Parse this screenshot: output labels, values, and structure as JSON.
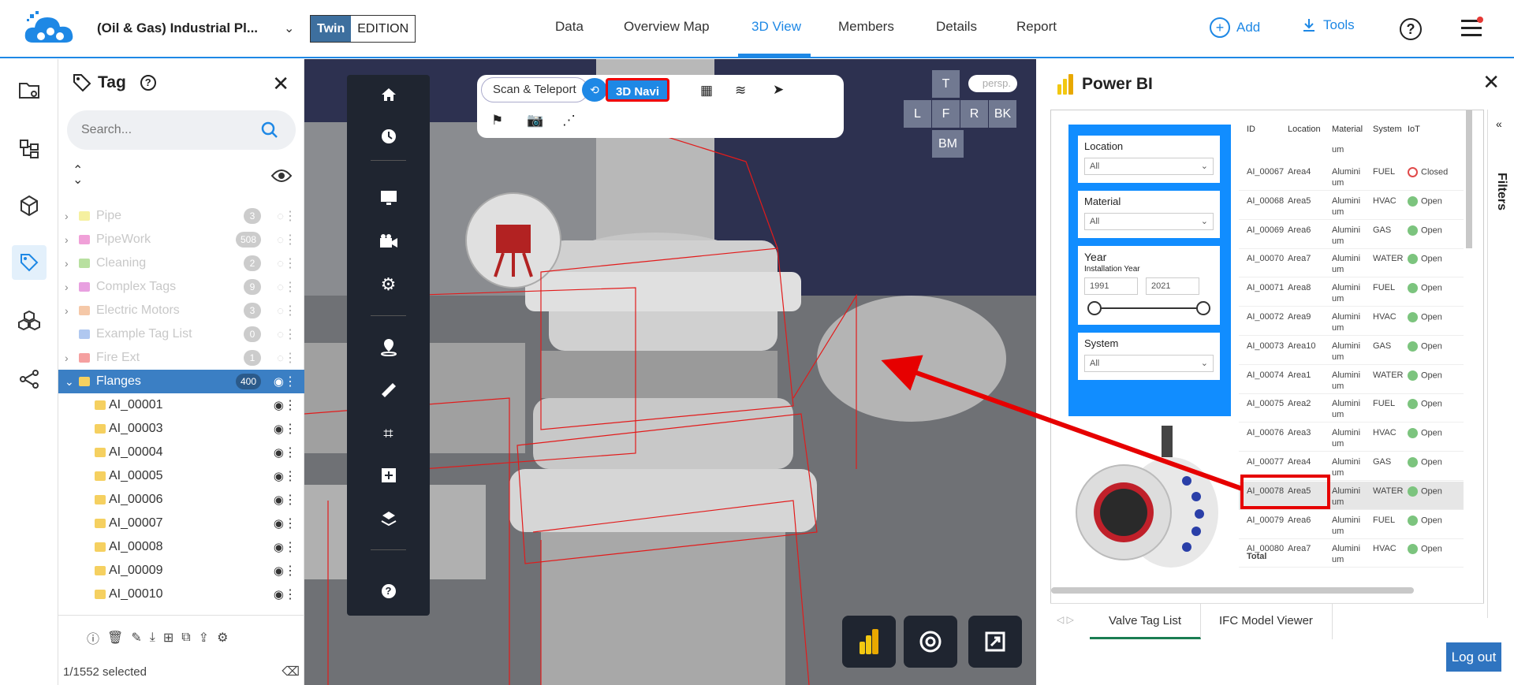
{
  "header": {
    "project": "(Oil & Gas) Industrial Pl...",
    "edition_twin": "Twin",
    "edition_label": "EDITION",
    "nav": [
      "Data",
      "Overview Map",
      "3D View",
      "Members",
      "Details",
      "Report"
    ],
    "active_nav": "3D View",
    "add_label": "Add",
    "tools_label": "Tools",
    "accent_color": "#1e88e5"
  },
  "rail": {
    "icons": [
      "folder-map-icon",
      "hierarchy-icon",
      "cube-icon",
      "tag-icon",
      "cubes-icon",
      "share-icon"
    ],
    "active": "tag-icon"
  },
  "tag_panel": {
    "title": "Tag",
    "search_placeholder": "Search...",
    "groups": [
      {
        "label": "Pipe",
        "count": "3",
        "color": "#f5f0a0"
      },
      {
        "label": "PipeWork",
        "count": "508",
        "color": "#f0a0d8"
      },
      {
        "label": "Cleaning",
        "count": "2",
        "color": "#b8e0a0"
      },
      {
        "label": "Complex Tags",
        "count": "9",
        "color": "#e8a0e0"
      },
      {
        "label": "Electric Motors",
        "count": "3",
        "color": "#f5c8a8"
      },
      {
        "label": "Example Tag List",
        "count": "0",
        "color": "#b0c8f0"
      },
      {
        "label": "Fire Ext",
        "count": "1",
        "color": "#f5a0a0"
      }
    ],
    "selected_group": {
      "label": "Flanges",
      "count": "400",
      "color": "#f5d060"
    },
    "children": [
      "AI_00001",
      "AI_00003",
      "AI_00004",
      "AI_00005",
      "AI_00006",
      "AI_00007",
      "AI_00008",
      "AI_00009",
      "AI_00010"
    ],
    "status": "1/1552 selected"
  },
  "viewer": {
    "scan_label": "Scan & Teleport",
    "navi_label": "3D Navi",
    "persp_label": "persp.",
    "viewcube": {
      "top": "T",
      "left": "L",
      "front": "F",
      "right": "R",
      "back": "BK",
      "bottom": "BM"
    }
  },
  "powerbi": {
    "title": "Power BI",
    "slicers": {
      "location": {
        "label": "Location",
        "value": "All"
      },
      "material": {
        "label": "Material",
        "value": "All"
      },
      "year": {
        "label": "Year",
        "sub": "Installation Year",
        "from": "1991",
        "to": "2021"
      },
      "system": {
        "label": "System",
        "value": "All"
      }
    },
    "table_headers": [
      "ID",
      "Location",
      "Material",
      "System",
      "IoT"
    ],
    "top_partial": "um",
    "rows": [
      {
        "id": "AI_00067",
        "loc": "Area4",
        "mat1": "Alumini",
        "mat2": "um",
        "sys": "FUEL",
        "iot": "Closed"
      },
      {
        "id": "AI_00068",
        "loc": "Area5",
        "mat1": "Alumini",
        "mat2": "um",
        "sys": "HVAC",
        "iot": "Open"
      },
      {
        "id": "AI_00069",
        "loc": "Area6",
        "mat1": "Alumini",
        "mat2": "um",
        "sys": "GAS",
        "iot": "Open"
      },
      {
        "id": "AI_00070",
        "loc": "Area7",
        "mat1": "Alumini",
        "mat2": "um",
        "sys": "WATER",
        "iot": "Open"
      },
      {
        "id": "AI_00071",
        "loc": "Area8",
        "mat1": "Alumini",
        "mat2": "um",
        "sys": "FUEL",
        "iot": "Open"
      },
      {
        "id": "AI_00072",
        "loc": "Area9",
        "mat1": "Alumini",
        "mat2": "um",
        "sys": "HVAC",
        "iot": "Open"
      },
      {
        "id": "AI_00073",
        "loc": "Area10",
        "mat1": "Alumini",
        "mat2": "um",
        "sys": "GAS",
        "iot": "Open"
      },
      {
        "id": "AI_00074",
        "loc": "Area1",
        "mat1": "Alumini",
        "mat2": "um",
        "sys": "WATER",
        "iot": "Open"
      },
      {
        "id": "AI_00075",
        "loc": "Area2",
        "mat1": "Alumini",
        "mat2": "um",
        "sys": "FUEL",
        "iot": "Open"
      },
      {
        "id": "AI_00076",
        "loc": "Area3",
        "mat1": "Alumini",
        "mat2": "um",
        "sys": "HVAC",
        "iot": "Open"
      },
      {
        "id": "AI_00077",
        "loc": "Area4",
        "mat1": "Alumini",
        "mat2": "um",
        "sys": "GAS",
        "iot": "Open"
      },
      {
        "id": "AI_00078",
        "loc": "Area5",
        "mat1": "Alumini",
        "mat2": "um",
        "sys": "WATER",
        "iot": "Open"
      },
      {
        "id": "AI_00079",
        "loc": "Area6",
        "mat1": "Alumini",
        "mat2": "um",
        "sys": "FUEL",
        "iot": "Open"
      },
      {
        "id": "AI_00080",
        "loc": "Area7",
        "mat1": "Alumini",
        "mat2": "um",
        "sys": "HVAC",
        "iot": "Open"
      }
    ],
    "highlighted_row": "AI_00078",
    "total_label": "Total",
    "filters_label": "Filters",
    "tabs": [
      "Valve Tag List",
      "IFC Model Viewer"
    ],
    "active_tab": "Valve Tag List",
    "logout_label": "Log out"
  }
}
